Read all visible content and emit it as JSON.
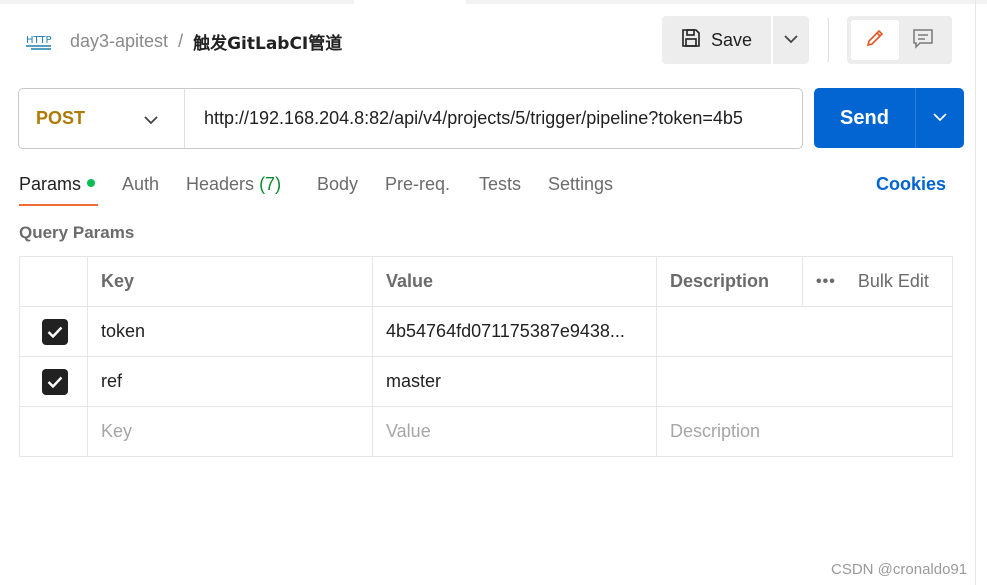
{
  "breadcrumb": {
    "collection": "day3-apitest",
    "separator": "/",
    "request_name": "触发GitLabCI管道"
  },
  "toolbar": {
    "save_label": "Save"
  },
  "request": {
    "method": "POST",
    "url": "http://192.168.204.8:82/api/v4/projects/5/trigger/pipeline?token=4b5",
    "send_label": "Send"
  },
  "tabs": [
    {
      "label": "Params"
    },
    {
      "label": "Auth"
    },
    {
      "label": "Headers",
      "count": "(7)"
    },
    {
      "label": "Body"
    },
    {
      "label": "Pre-req."
    },
    {
      "label": "Tests"
    },
    {
      "label": "Settings"
    }
  ],
  "cookies_label": "Cookies",
  "query_params": {
    "title": "Query Params",
    "columns": {
      "key": "Key",
      "value": "Value",
      "description": "Description",
      "bulk_edit": "Bulk Edit"
    },
    "rows": [
      {
        "key": "token",
        "value": "4b54764fd071175387e9438...",
        "description": ""
      },
      {
        "key": "ref",
        "value": "master",
        "description": ""
      }
    ],
    "placeholders": {
      "key": "Key",
      "value": "Value",
      "description": "Description"
    }
  },
  "watermark": "CSDN @cronaldo91",
  "colors": {
    "method": "#ad7a03",
    "send": "#0265d2",
    "tab_underline": "#f26b3a",
    "params_dot": "#0cbb52",
    "headers_count": "#0d8a2e"
  }
}
